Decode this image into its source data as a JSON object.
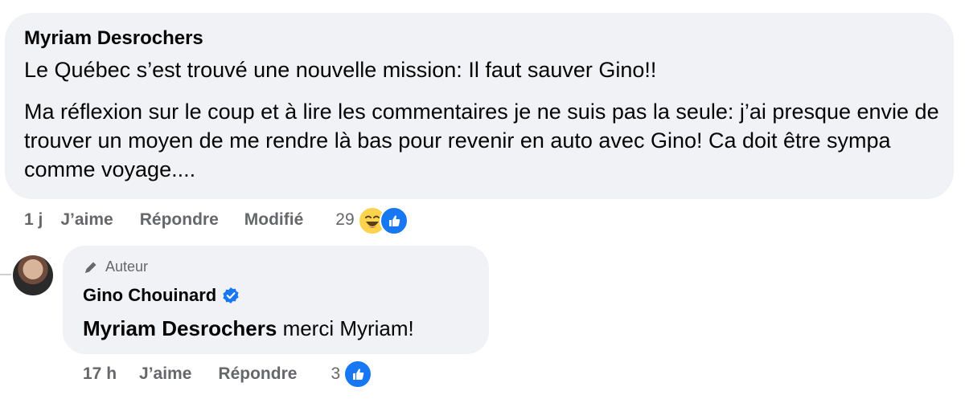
{
  "comment": {
    "author": "Myriam Desrochers",
    "line1": "Le Québec s’est trouvé une nouvelle mission: Il faut sauver Gino!!",
    "paragraph2": "Ma réflexion sur le coup et à lire les commentaires je ne suis pas la seule: j’ai presque envie de trouver un moyen de me rendre là bas pour revenir en auto avec Gino! Ca doit être sympa comme voyage....",
    "actions": {
      "time": "1 j",
      "like_label": "J’aime",
      "reply_label": "Répondre",
      "edited_label": "Modifié",
      "reaction_count": "29"
    },
    "reactions": [
      "haha-emoji-icon",
      "like-reaction-icon"
    ]
  },
  "reply": {
    "badge_label": "Auteur",
    "author": "Gino Chouinard",
    "mention": "Myriam Desrochers",
    "text": " merci Myriam!",
    "actions": {
      "time": "17 h",
      "like_label": "J’aime",
      "reply_label": "Répondre",
      "reaction_count": "3"
    },
    "reactions": [
      "like-reaction-icon"
    ]
  },
  "colors": {
    "bubble": "#f0f2f5",
    "meta_text": "#65676b",
    "brand_blue": "#1877f2",
    "haha_yellow": "#fcd34d"
  }
}
